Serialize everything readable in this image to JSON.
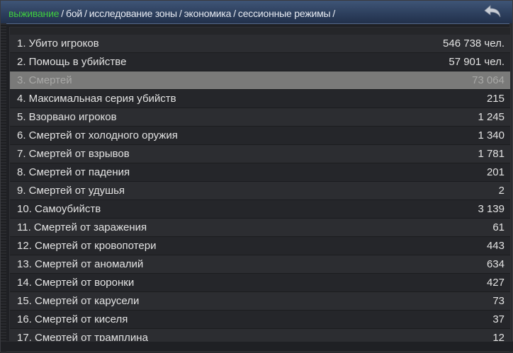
{
  "tabs": [
    {
      "label": "выживание",
      "active": true
    },
    {
      "label": "бой",
      "active": false
    },
    {
      "label": "исследование зоны",
      "active": false
    },
    {
      "label": "экономика",
      "active": false
    },
    {
      "label": "сессионные режимы",
      "active": false
    }
  ],
  "separator": "/",
  "icons": {
    "back": "back-arrow-icon"
  },
  "colors": {
    "active_tab": "#3fcc3f",
    "header": "#2c3e5c",
    "selected_row": "#7a7a79"
  },
  "stats": [
    {
      "label": "1. Убито игроков",
      "value": "546 738 чел."
    },
    {
      "label": "2. Помощь в убийстве",
      "value": "57 901 чел."
    },
    {
      "label": "3. Смертей",
      "value": "73 064",
      "selected": true
    },
    {
      "label": "4. Максимальная серия убийств",
      "value": "215"
    },
    {
      "label": "5. Взорвано игроков",
      "value": "1 245"
    },
    {
      "label": "6. Смертей от холодного оружия",
      "value": "1 340"
    },
    {
      "label": "7. Смертей от взрывов",
      "value": "1 781"
    },
    {
      "label": "8. Смертей от падения",
      "value": "201"
    },
    {
      "label": "9. Смертей от удушья",
      "value": "2"
    },
    {
      "label": "10. Самоубийств",
      "value": "3 139"
    },
    {
      "label": "11. Смертей от заражения",
      "value": "61"
    },
    {
      "label": "12. Смертей от кровопотери",
      "value": "443"
    },
    {
      "label": "13. Смертей от аномалий",
      "value": "634"
    },
    {
      "label": "14. Смертей от воронки",
      "value": "427"
    },
    {
      "label": "15. Смертей от карусели",
      "value": "73"
    },
    {
      "label": "16. Смертей от киселя",
      "value": "37"
    },
    {
      "label": "17. Смертей от трамплина",
      "value": "12"
    }
  ]
}
